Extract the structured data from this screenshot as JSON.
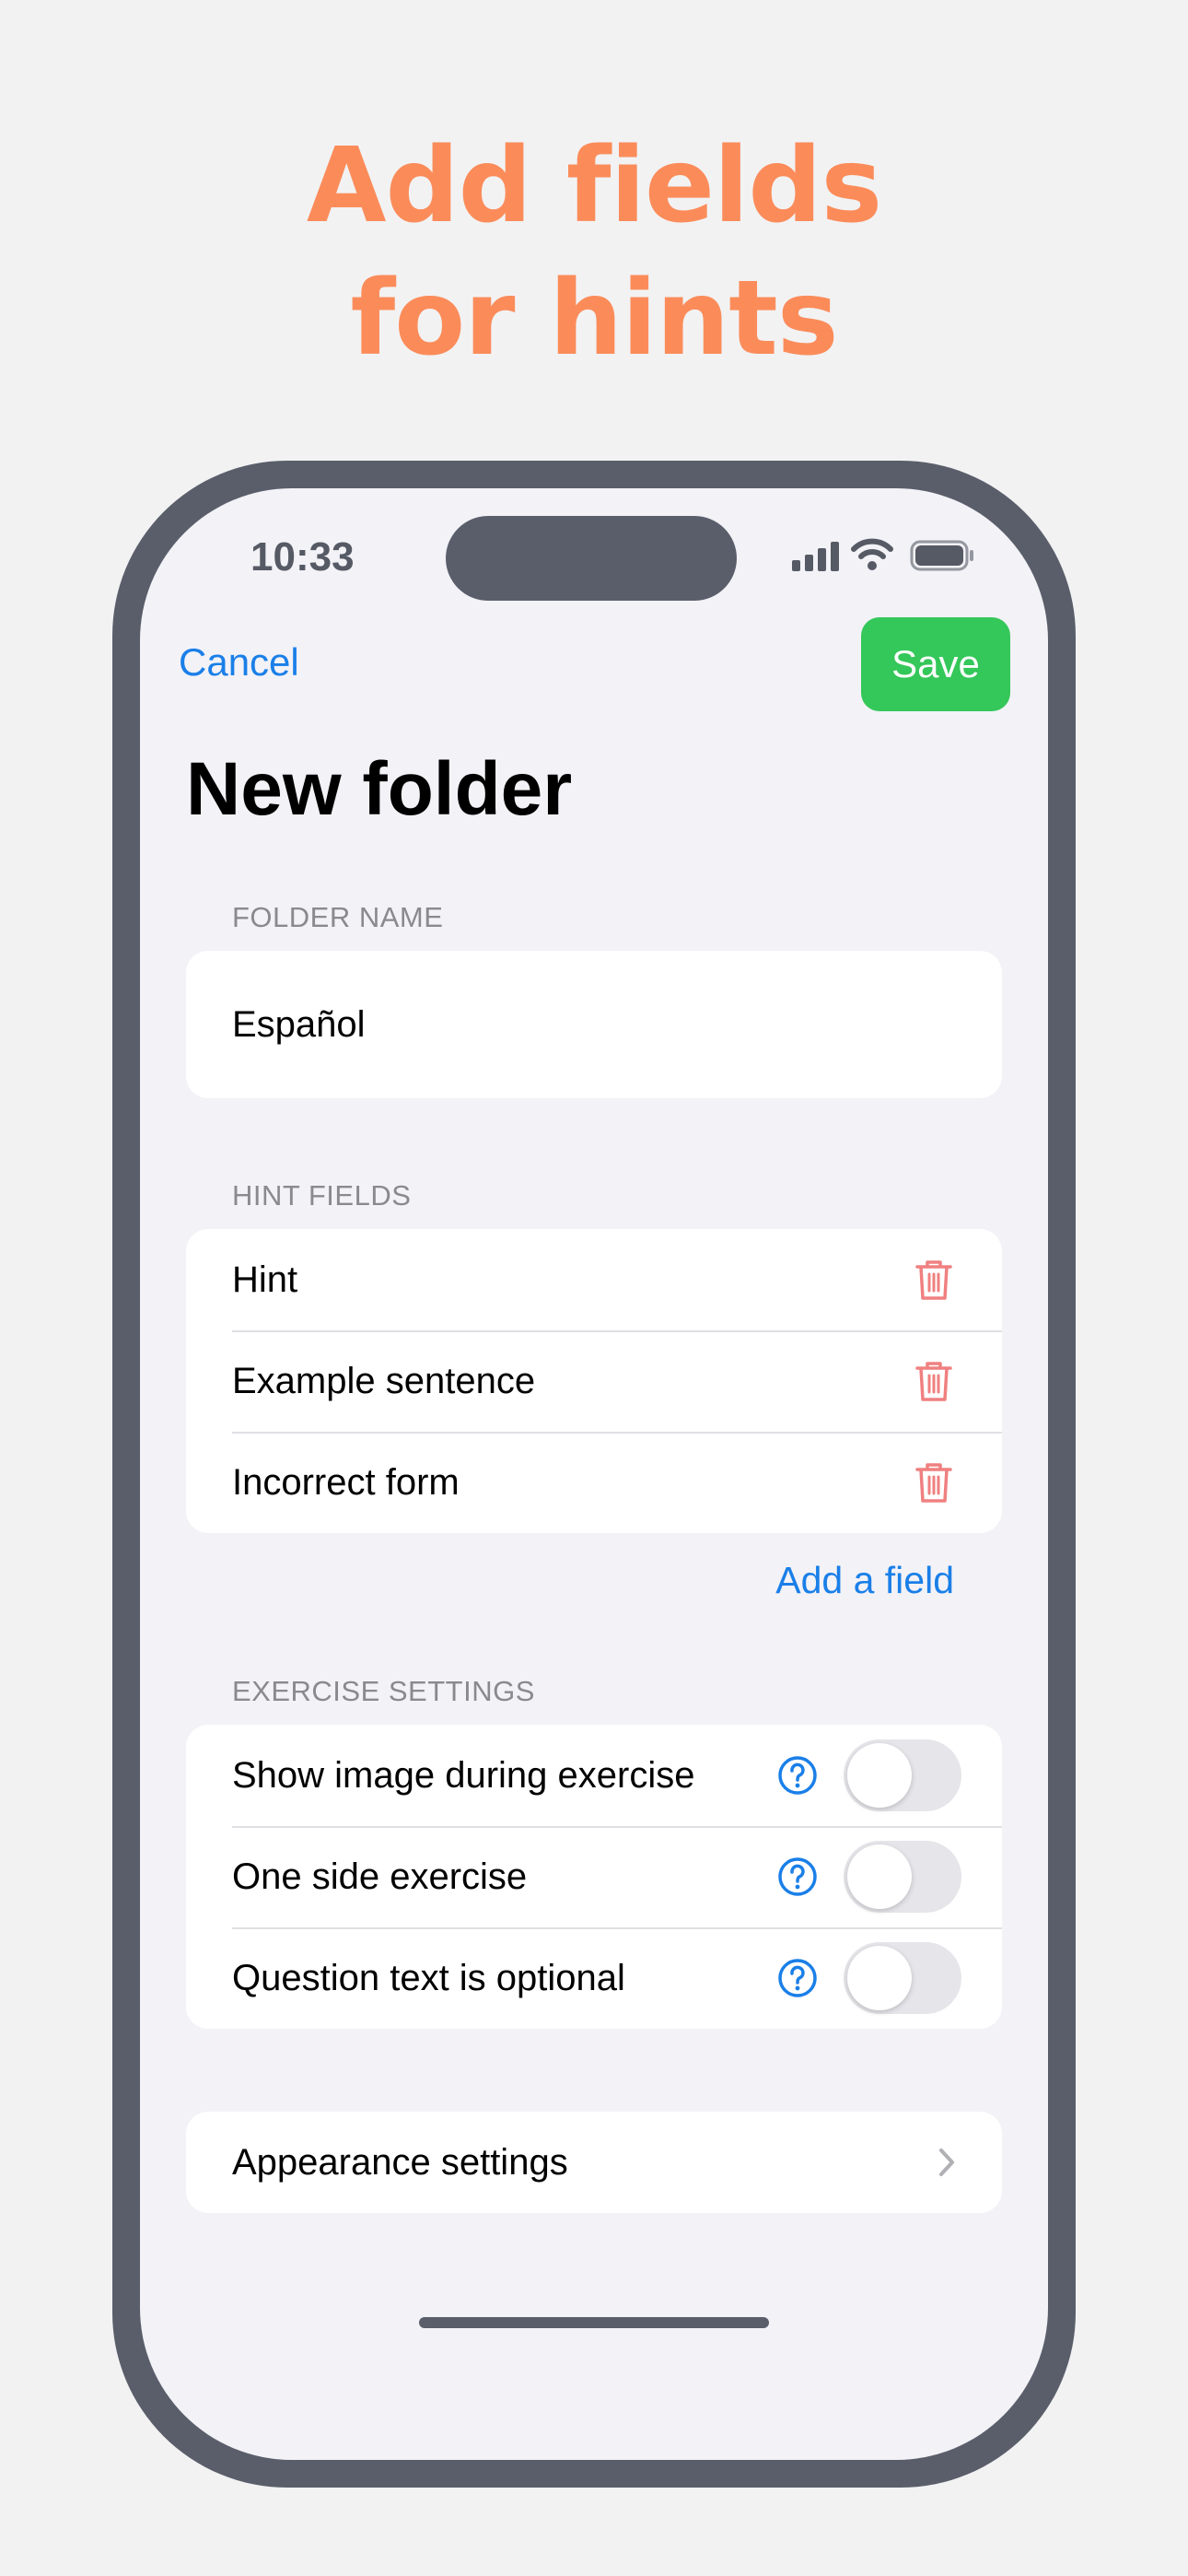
{
  "headline": {
    "line1": "Add fields",
    "line2": "for hints"
  },
  "status_bar": {
    "time": "10:33"
  },
  "nav": {
    "cancel_label": "Cancel",
    "save_label": "Save"
  },
  "title": "New folder",
  "folder_name": {
    "label": "FOLDER NAME",
    "value": "Español"
  },
  "hint_fields": {
    "label": "HINT FIELDS",
    "items": [
      {
        "label": "Hint"
      },
      {
        "label": "Example sentence"
      },
      {
        "label": "Incorrect form"
      }
    ],
    "add_label": "Add a field"
  },
  "exercise_settings": {
    "label": "EXERCISE SETTINGS",
    "items": [
      {
        "label": "Show image during exercise",
        "enabled": false
      },
      {
        "label": "One side exercise",
        "enabled": false
      },
      {
        "label": "Question text is optional",
        "enabled": false
      }
    ]
  },
  "appearance": {
    "label": "Appearance settings"
  },
  "colors": {
    "accent": "#1a7fe8",
    "save": "#34c759",
    "headline": "#fb8c5a",
    "trash": "#f08080",
    "phone_frame": "#595e6a"
  },
  "icons": {
    "trash": "trash-icon",
    "help": "question-circle-icon",
    "chevron": "chevron-right-icon",
    "signal": "cellular-signal-icon",
    "wifi": "wifi-icon",
    "battery": "battery-icon"
  }
}
